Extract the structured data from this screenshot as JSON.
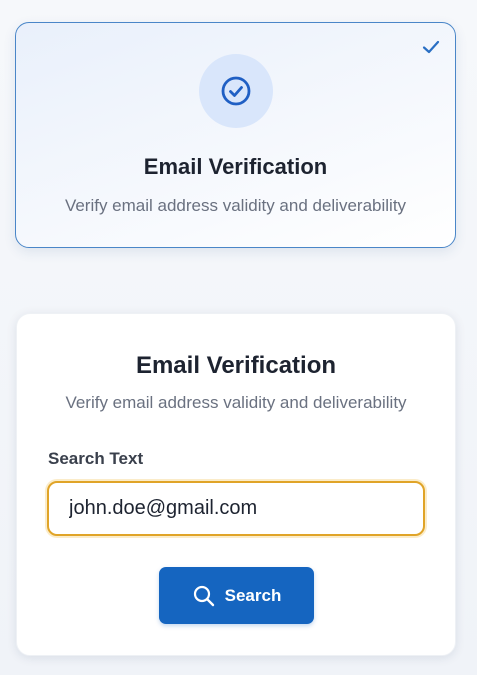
{
  "option_card": {
    "title": "Email Verification",
    "description": "Verify email address validity and deliverability",
    "selected": true,
    "icon": "check-circle-icon",
    "selected_indicator_icon": "checkmark-icon"
  },
  "form": {
    "title": "Email Verification",
    "description": "Verify email address validity and deliverability",
    "search_label": "Search Text",
    "search_value": "john.doe@gmail.com",
    "search_button_label": "Search",
    "search_button_icon": "search-icon"
  },
  "colors": {
    "accent": "#1565c0",
    "card_border_selected": "#4a86c8",
    "input_focus_border": "#e0a428",
    "icon_circle_bg": "#d9e6fb"
  }
}
